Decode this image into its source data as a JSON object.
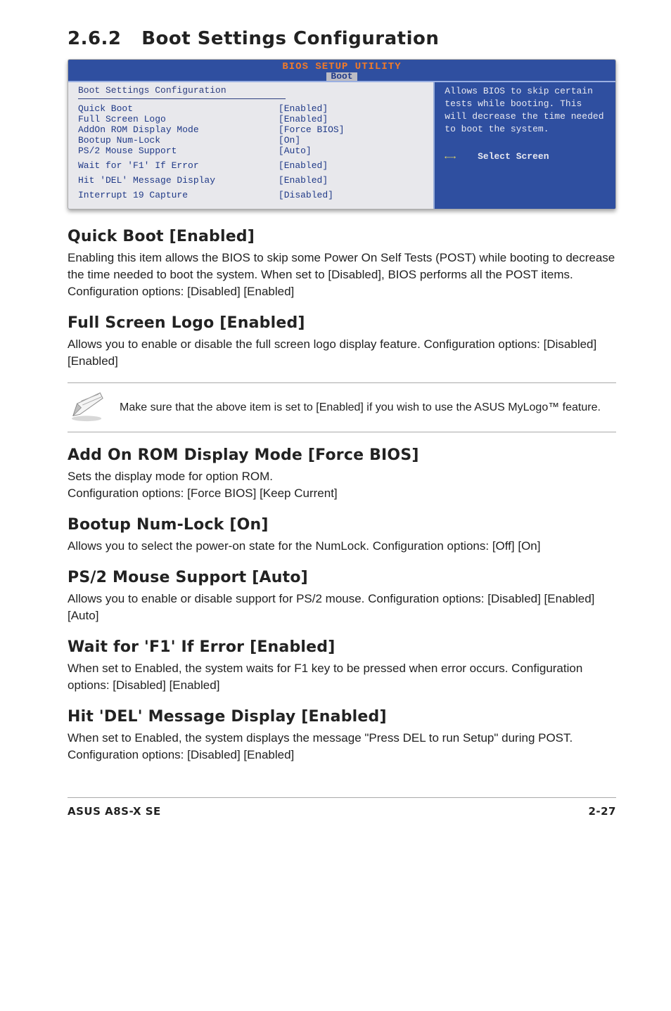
{
  "section": {
    "number": "2.6.2",
    "title": "Boot Settings Configuration"
  },
  "bios": {
    "header": "BIOS SETUP UTILITY",
    "tab": "Boot",
    "panel_title": "Boot Settings Configuration",
    "rows": [
      {
        "k": "Quick Boot",
        "v": "[Enabled]"
      },
      {
        "k": "Full Screen Logo",
        "v": "[Enabled]"
      },
      {
        "k": "AddOn ROM Display Mode",
        "v": "[Force BIOS]"
      },
      {
        "k": "Bootup Num-Lock",
        "v": "[On]"
      },
      {
        "k": "PS/2 Mouse Support",
        "v": "[Auto]"
      }
    ],
    "rows2": [
      {
        "k": "Wait for 'F1' If Error",
        "v": "[Enabled]"
      },
      {
        "k": "Hit 'DEL' Message Display",
        "v": "[Enabled]"
      },
      {
        "k": "Interrupt 19 Capture",
        "v": "[Disabled]"
      }
    ],
    "help": "Allows BIOS to skip certain tests while booting. This will decrease the time needed to boot the system.",
    "nav_arrows": "←→",
    "nav_label": "Select Screen"
  },
  "options": {
    "quick_boot": {
      "heading": "Quick Boot [Enabled]",
      "body": "Enabling this item allows the BIOS to skip some Power On Self Tests (POST) while booting to decrease the time needed to boot the system. When set to [Disabled], BIOS performs all the POST items. Configuration options: [Disabled] [Enabled]"
    },
    "full_screen_logo": {
      "heading": "Full Screen Logo [Enabled]",
      "body": "Allows you to enable or disable the full screen logo display feature. Configuration options: [Disabled] [Enabled]"
    },
    "note": {
      "text": "Make sure that the above item is set to [Enabled] if you wish to use the ASUS MyLogo™ feature."
    },
    "addon_rom": {
      "heading": "Add On ROM Display Mode [Force BIOS]",
      "body": "Sets the display mode for option ROM.\nConfiguration options: [Force BIOS] [Keep Current]"
    },
    "bootup_numlock": {
      "heading": "Bootup Num-Lock [On]",
      "body": "Allows you to select the power-on state for the NumLock. Configuration options: [Off] [On]"
    },
    "ps2_mouse": {
      "heading": "PS/2 Mouse Support [Auto]",
      "body": "Allows you to enable or disable support for PS/2 mouse. Configuration options: [Disabled] [Enabled] [Auto]"
    },
    "wait_f1": {
      "heading": "Wait for 'F1' If Error [Enabled]",
      "body": "When set to Enabled, the system waits for F1 key to be pressed when error occurs. Configuration options: [Disabled] [Enabled]"
    },
    "hit_del": {
      "heading": "Hit 'DEL' Message Display [Enabled]",
      "body": "When set to Enabled, the system displays the message \"Press DEL to run Setup\" during POST. Configuration options: [Disabled] [Enabled]"
    }
  },
  "footer": {
    "left": "ASUS A8S-X SE",
    "right": "2-27"
  }
}
